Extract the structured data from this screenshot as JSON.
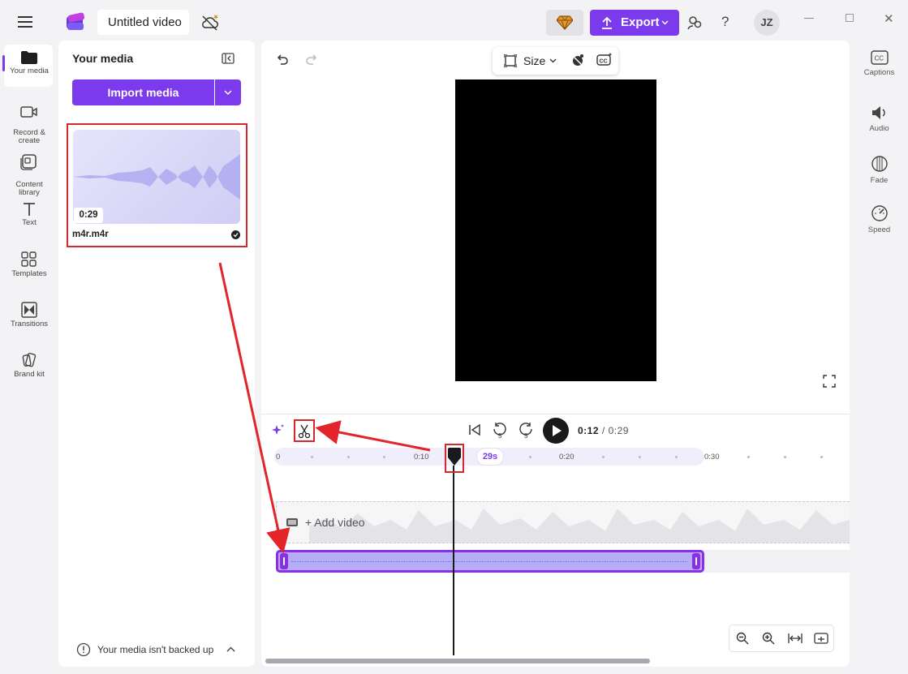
{
  "app": {
    "title": "Untitled video",
    "avatar_initials": "JZ",
    "accent_color": "#7c3aed",
    "highlight_color": "#d8262b"
  },
  "topbar": {
    "export_label": "Export",
    "help_label": "?"
  },
  "left_rail": {
    "items": [
      {
        "label": "Your media",
        "icon": "folder-icon"
      },
      {
        "label": "Record &\ncreate",
        "icon": "video-camera-icon"
      },
      {
        "label": "Content\nlibrary",
        "icon": "library-icon"
      },
      {
        "label": "Text",
        "icon": "text-icon"
      },
      {
        "label": "Templates",
        "icon": "templates-icon"
      },
      {
        "label": "Transitions",
        "icon": "transitions-icon"
      },
      {
        "label": "Brand kit",
        "icon": "brand-kit-icon"
      }
    ]
  },
  "media_panel": {
    "title": "Your media",
    "import_label": "Import media",
    "file": {
      "name": "m4r.m4r",
      "duration": "0:29"
    },
    "backup_text": "Your media isn't backed up"
  },
  "preview": {
    "size_label": "Size"
  },
  "playback": {
    "current_time": "0:12",
    "separator": "/",
    "total_time": "0:29"
  },
  "timeline": {
    "ticks": [
      "0",
      "0:10",
      "0:20",
      "0:30"
    ],
    "clip_duration_chip": "29s",
    "add_video_label": "+ Add video"
  },
  "right_rail": {
    "items": [
      {
        "label": "Captions",
        "icon": "captions-icon"
      },
      {
        "label": "Audio",
        "icon": "speaker-icon"
      },
      {
        "label": "Fade",
        "icon": "fade-icon"
      },
      {
        "label": "Speed",
        "icon": "speedometer-icon"
      }
    ]
  }
}
